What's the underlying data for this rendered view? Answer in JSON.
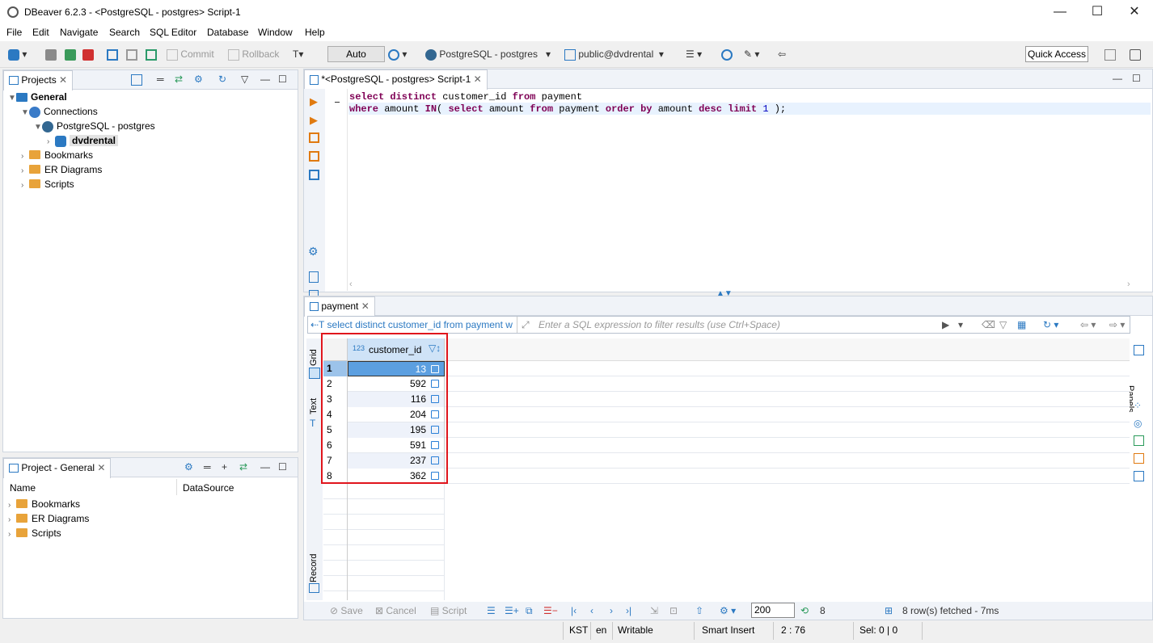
{
  "window": {
    "title": "DBeaver 6.2.3 - <PostgreSQL - postgres> Script-1"
  },
  "menu": [
    "File",
    "Edit",
    "Navigate",
    "Search",
    "SQL Editor",
    "Database",
    "Window",
    "Help"
  ],
  "toolbar": {
    "commit": "Commit",
    "rollback": "Rollback",
    "auto": "Auto",
    "connection": "PostgreSQL - postgres",
    "schema": "public@dvdrental",
    "quick_access": "Quick Access"
  },
  "projects": {
    "tab": "Projects",
    "tree": {
      "general": "General",
      "connections": "Connections",
      "pg": "PostgreSQL - postgres",
      "db": "dvdrental",
      "bookmarks": "Bookmarks",
      "er": "ER Diagrams",
      "scripts": "Scripts"
    }
  },
  "project_general": {
    "tab": "Project - General",
    "col_name": "Name",
    "col_ds": "DataSource",
    "items": [
      "Bookmarks",
      "ER Diagrams",
      "Scripts"
    ]
  },
  "editor": {
    "tab": "*<PostgreSQL - postgres> Script-1",
    "line1": {
      "a": "select distinct",
      "b": " customer_id ",
      "c": "from",
      "d": " payment"
    },
    "line2": {
      "a": "where",
      "b": " amount ",
      "c": "IN",
      "d": "( ",
      "e": "select",
      "f": " amount ",
      "g": "from",
      "h": " payment ",
      "i": "order by",
      "j": " amount ",
      "k": "desc limit",
      "l": " ",
      "m": "1",
      "n": " );"
    }
  },
  "results": {
    "tab": "payment",
    "query_label": "select distinct customer_id from payment w",
    "filter_placeholder": "Enter a SQL expression to filter results (use Ctrl+Space)",
    "column": "customer_id",
    "column_type": "123",
    "rows": [
      {
        "n": "1",
        "v": "13"
      },
      {
        "n": "2",
        "v": "592"
      },
      {
        "n": "3",
        "v": "116"
      },
      {
        "n": "4",
        "v": "204"
      },
      {
        "n": "5",
        "v": "195"
      },
      {
        "n": "6",
        "v": "591"
      },
      {
        "n": "7",
        "v": "237"
      },
      {
        "n": "8",
        "v": "362"
      }
    ],
    "side_tabs": {
      "grid": "Grid",
      "text": "Text",
      "record": "Record",
      "panels": "Panels"
    },
    "bottom": {
      "save": "Save",
      "cancel": "Cancel",
      "script": "Script",
      "fetch_size": "200",
      "count": "8",
      "fetched": "8 row(s) fetched - 7ms"
    }
  },
  "status": {
    "tz": "KST",
    "lang": "en",
    "mode": "Writable",
    "insert": "Smart Insert",
    "pos": "2 : 76",
    "sel": "Sel: 0 | 0"
  }
}
